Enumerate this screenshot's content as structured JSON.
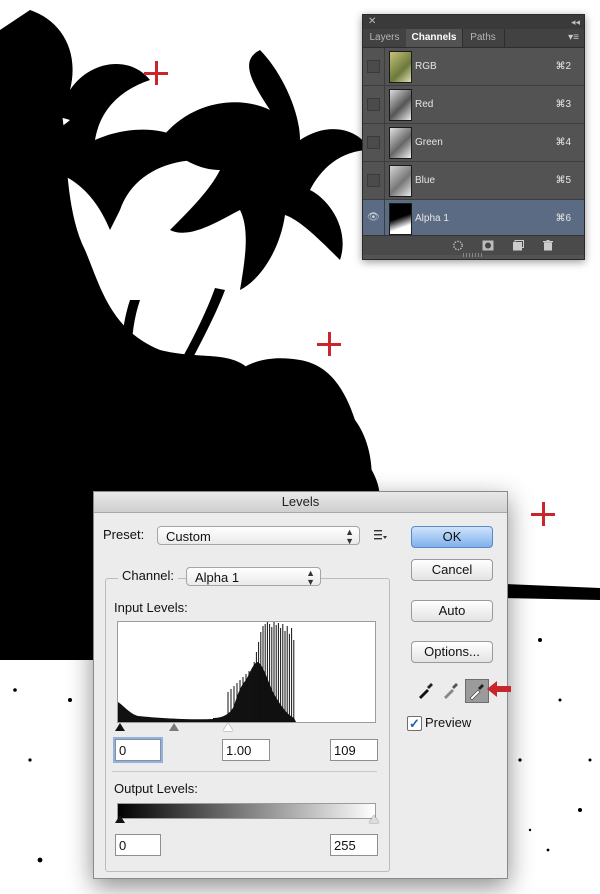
{
  "colors": {
    "accent_red": "#c8262b",
    "panel_bg": "#535353",
    "panel_selected": "#5a6b83",
    "ok_blue": "#7fb1ec"
  },
  "channels_panel": {
    "close_icon": "close-icon",
    "collapse_icon": "double-chevron-icon",
    "tabs": [
      {
        "label": "Layers",
        "active": false
      },
      {
        "label": "Channels",
        "active": true
      },
      {
        "label": "Paths",
        "active": false
      }
    ],
    "rows": [
      {
        "name": "RGB",
        "shortcut": "⌘2",
        "visible": false,
        "selected": false
      },
      {
        "name": "Red",
        "shortcut": "⌘3",
        "visible": false,
        "selected": false
      },
      {
        "name": "Green",
        "shortcut": "⌘4",
        "visible": false,
        "selected": false
      },
      {
        "name": "Blue",
        "shortcut": "⌘5",
        "visible": false,
        "selected": false
      },
      {
        "name": "Alpha 1",
        "shortcut": "⌘6",
        "visible": true,
        "selected": true
      }
    ],
    "bottom_icons": [
      "load-selection-icon",
      "save-selection-icon",
      "new-channel-icon",
      "trash-icon"
    ]
  },
  "levels": {
    "title": "Levels",
    "preset_label": "Preset:",
    "preset_value": "Custom",
    "channel_label": "Channel:",
    "channel_value": "Alpha 1",
    "input_levels_label": "Input Levels:",
    "input_black": "0",
    "input_gamma": "1.00",
    "input_white": "109",
    "output_levels_label": "Output Levels:",
    "output_black": "0",
    "output_white": "255",
    "buttons": {
      "ok": "OK",
      "cancel": "Cancel",
      "auto": "Auto",
      "options": "Options..."
    },
    "preview_label": "Preview",
    "preview_checked": true,
    "eyedroppers": [
      "black-eyedropper-icon",
      "gray-eyedropper-icon",
      "white-eyedropper-icon"
    ],
    "selected_eyedropper": "white"
  }
}
